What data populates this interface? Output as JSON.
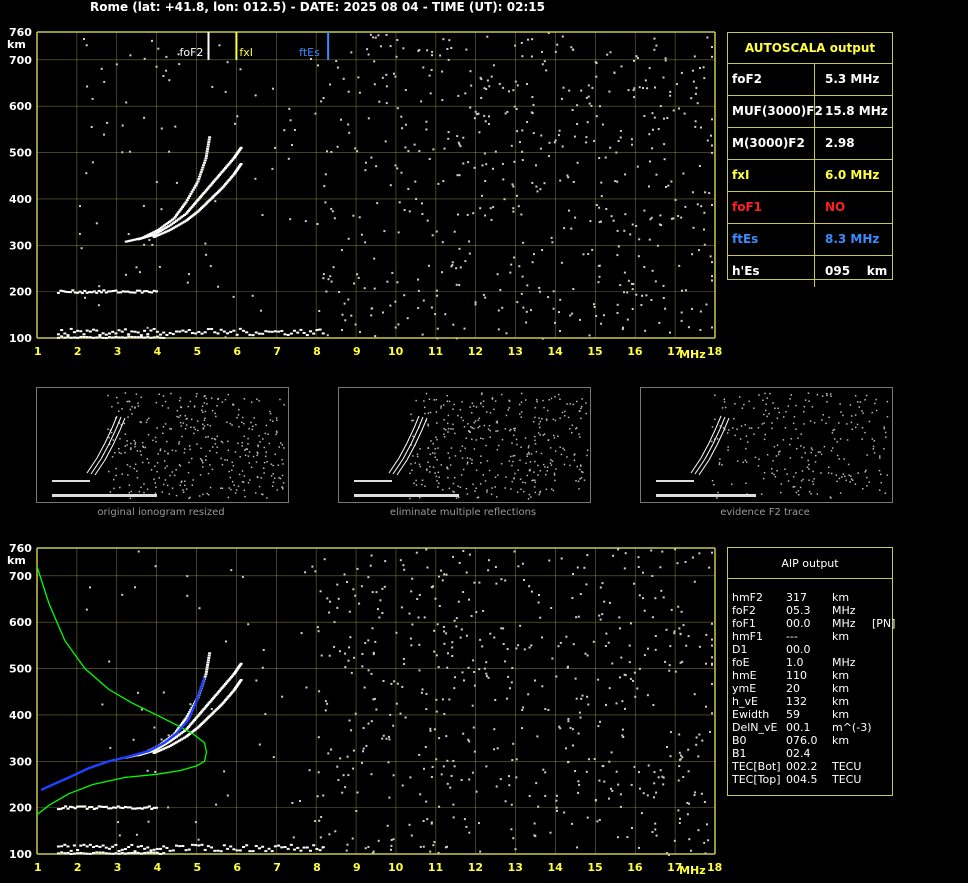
{
  "header": "Rome (lat: +41.8, lon: 012.5) - DATE: 2025 08 04 - TIME (UT): 02:15",
  "autoscala": {
    "title": "AUTOSCALA output",
    "rows": [
      {
        "label": "foF2",
        "value": "5.3 MHz",
        "color": "#ffffff"
      },
      {
        "label": "MUF(3000)F2",
        "value": "15.8 MHz",
        "color": "#ffffff"
      },
      {
        "label": "M(3000)F2",
        "value": "2.98",
        "color": "#ffffff"
      },
      {
        "label": "fxI",
        "value": "6.0 MHz",
        "color": "#ffff40"
      },
      {
        "label": "foF1",
        "value": "NO",
        "color": "#ff2020"
      },
      {
        "label": "ftEs",
        "value": "8.3 MHz",
        "color": "#3a8cff"
      },
      {
        "label": "h'Es",
        "value": "095    km",
        "color": "#ffffff"
      }
    ]
  },
  "aip": {
    "title": "AIP output",
    "rows": [
      {
        "k": "hmF2",
        "v": "317",
        "u": "km",
        "x": ""
      },
      {
        "k": "foF2",
        "v": "05.3",
        "u": "MHz",
        "x": ""
      },
      {
        "k": "foF1",
        "v": "00.0",
        "u": "MHz",
        "x": "[PN]"
      },
      {
        "k": "hmF1",
        "v": "---",
        "u": "km",
        "x": ""
      },
      {
        "k": "D1",
        "v": "00.0",
        "u": "",
        "x": ""
      },
      {
        "k": "foE",
        "v": "1.0",
        "u": "MHz",
        "x": ""
      },
      {
        "k": "hmE",
        "v": "110",
        "u": "km",
        "x": ""
      },
      {
        "k": "ymE",
        "v": "20",
        "u": "km",
        "x": ""
      },
      {
        "k": "h_vE",
        "v": "132",
        "u": "km",
        "x": ""
      },
      {
        "k": "Ewidth",
        "v": "59",
        "u": "km",
        "x": ""
      },
      {
        "k": "DelN_vE",
        "v": "00.1",
        "u": "m^(-3)",
        "x": ""
      },
      {
        "k": "B0",
        "v": "076.0",
        "u": "km",
        "x": ""
      },
      {
        "k": "B1",
        "v": "02.4",
        "u": "",
        "x": ""
      },
      {
        "k": "TEC[Bot]",
        "v": "002.2",
        "u": "TECU",
        "x": ""
      },
      {
        "k": "TEC[Top]",
        "v": "004.5",
        "u": "TECU",
        "x": ""
      }
    ]
  },
  "thumbs": {
    "captions": [
      "original ionogram resized",
      "eliminate multiple reflections",
      "evidence F2 trace"
    ]
  },
  "colors": {
    "grid": "#c8c850",
    "axis_text": "#ffff40",
    "foF2": "#ffffff",
    "fxI": "#ffff40",
    "ftEs": "#3a8cff",
    "profile": "#00ff00",
    "trace": "#2040ff"
  },
  "chart_data": [
    {
      "type": "scatter",
      "title": "",
      "xlabel": "MHz",
      "ylabel": "km",
      "xlim": [
        1,
        18
      ],
      "ylim": [
        100,
        760
      ],
      "xticks": [
        1,
        2,
        3,
        4,
        5,
        6,
        7,
        8,
        9,
        10,
        11,
        12,
        13,
        14,
        15,
        16,
        17,
        18
      ],
      "yticks": [
        100,
        200,
        300,
        400,
        500,
        600,
        700,
        760
      ],
      "grid": true,
      "markers": [
        {
          "name": "foF2",
          "x": 5.3,
          "color": "#ffffff"
        },
        {
          "name": "fxI",
          "x": 6.0,
          "color": "#ffff40"
        },
        {
          "name": "ftEs",
          "x": 8.3,
          "color": "#3a8cff"
        }
      ],
      "echo_traces": [
        {
          "x": [
            3.2,
            3.6,
            4.0,
            4.4,
            4.7,
            5.0,
            5.2,
            5.3
          ],
          "y": [
            310,
            318,
            335,
            360,
            395,
            440,
            490,
            540
          ]
        },
        {
          "x": [
            3.5,
            3.9,
            4.3,
            4.7,
            5.0,
            5.3,
            5.6,
            5.9,
            6.1
          ],
          "y": [
            315,
            325,
            345,
            370,
            400,
            430,
            460,
            490,
            515
          ]
        },
        {
          "x": [
            3.9,
            4.3,
            4.7,
            5.0,
            5.3,
            5.6,
            5.9,
            6.1
          ],
          "y": [
            320,
            335,
            355,
            375,
            400,
            425,
            455,
            480
          ]
        }
      ],
      "es_layer": {
        "x": [
          1.5,
          8.2
        ],
        "y": [
          100,
          120
        ]
      },
      "second_hop": {
        "x": [
          1.5,
          4.0
        ],
        "y": [
          200,
          200
        ]
      }
    },
    {
      "type": "line",
      "title": "",
      "xlabel": "MHz",
      "ylabel": "km",
      "xlim": [
        1,
        18
      ],
      "ylim": [
        100,
        760
      ],
      "xticks": [
        1,
        2,
        3,
        4,
        5,
        6,
        7,
        8,
        9,
        10,
        11,
        12,
        13,
        14,
        15,
        16,
        17,
        18
      ],
      "yticks": [
        100,
        200,
        300,
        400,
        500,
        600,
        700,
        760
      ],
      "grid": true,
      "series": [
        {
          "color": "#00ff00",
          "x": [
            1.0,
            1.3,
            1.7,
            2.2,
            2.8,
            3.4,
            4.0,
            4.5,
            4.9,
            5.2,
            5.25,
            5.2,
            5.0,
            4.6,
            4.0,
            3.2,
            2.4,
            1.8,
            1.3,
            1.0
          ],
          "y": [
            720,
            640,
            560,
            500,
            455,
            425,
            400,
            378,
            360,
            340,
            320,
            300,
            290,
            280,
            272,
            265,
            250,
            230,
            205,
            185
          ]
        },
        {
          "color": "#2040ff",
          "x": [
            1.1,
            1.4,
            1.8,
            2.3,
            2.8,
            3.3,
            3.8,
            4.2,
            4.5,
            4.8,
            5.0,
            5.2
          ],
          "y": [
            238,
            250,
            265,
            285,
            300,
            310,
            322,
            340,
            360,
            390,
            430,
            480
          ]
        }
      ]
    }
  ]
}
